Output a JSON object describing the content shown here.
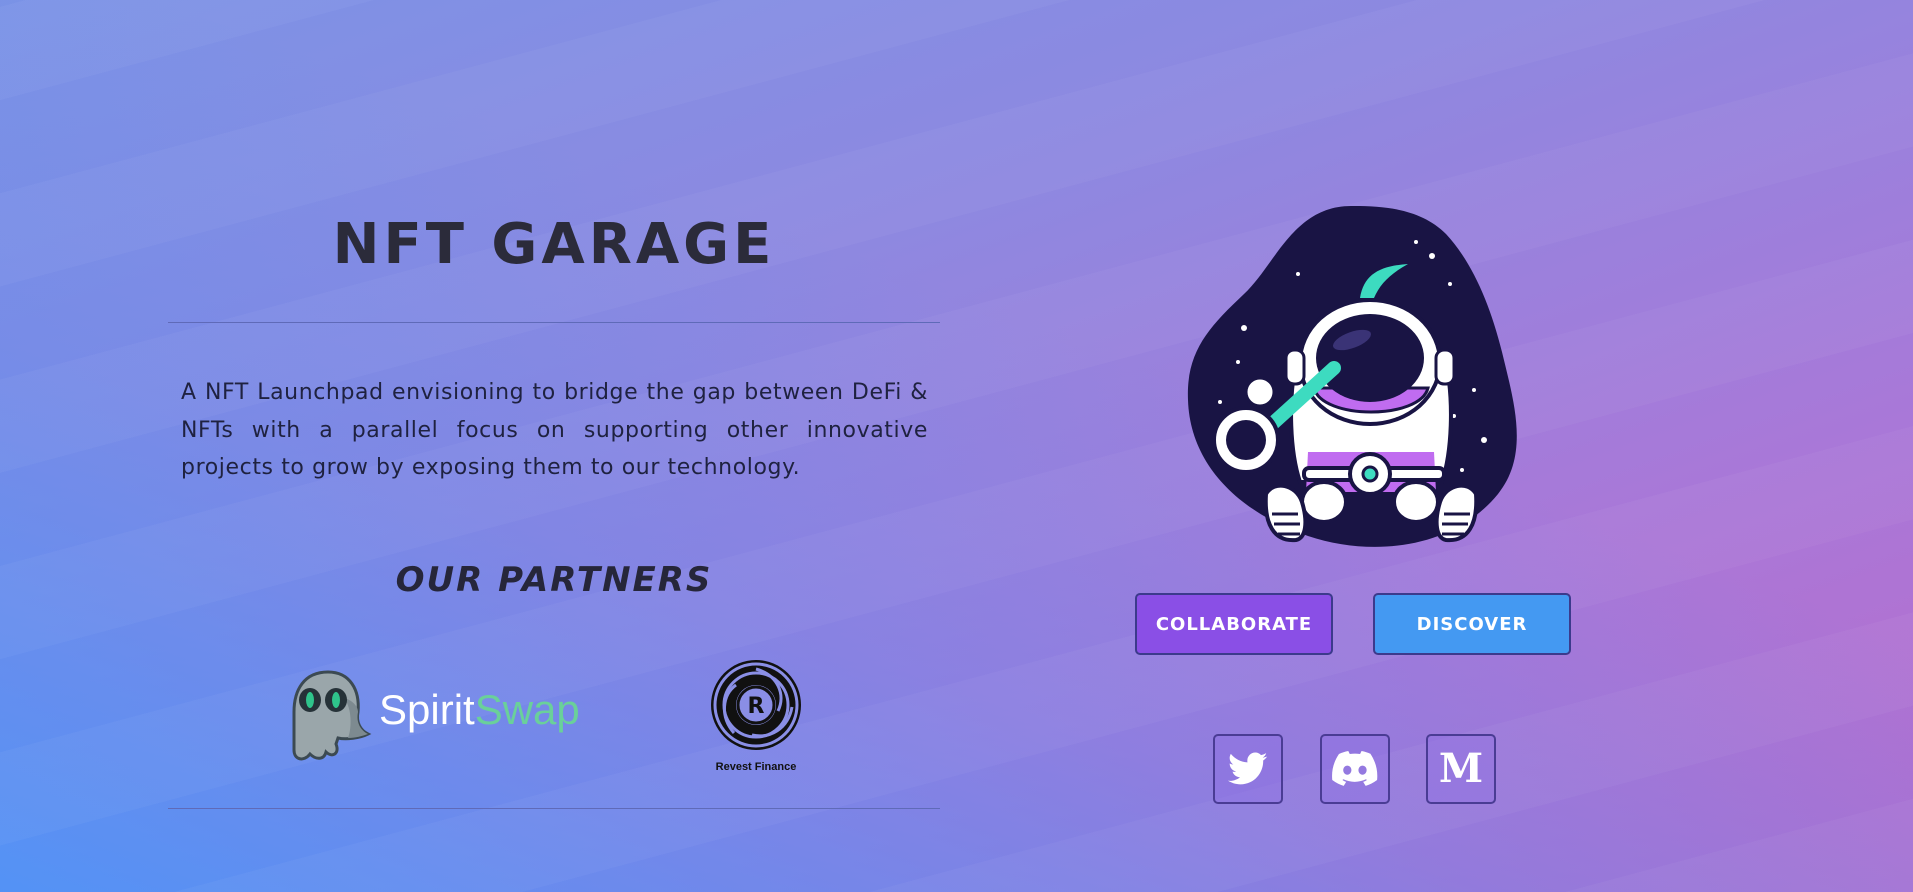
{
  "site": {
    "title": "NFT GARAGE",
    "description": "A NFT Launchpad envisioning to bridge the gap between DeFi & NFTs with a parallel focus on supporting other innovative projects to grow by exposing them to our technology.",
    "partners_heading": "OUR PARTNERS"
  },
  "partners": [
    {
      "name_part1": "Spirit",
      "name_part2": "Swap",
      "icon": "ghost-logo"
    },
    {
      "name": "Revest Finance",
      "icon": "revest-logo"
    }
  ],
  "actions": {
    "collaborate": "COLLABORATE",
    "discover": "DISCOVER"
  },
  "social": [
    {
      "icon": "twitter-icon"
    },
    {
      "icon": "discord-icon"
    },
    {
      "icon": "medium-icon",
      "glyph": "M"
    }
  ],
  "colors": {
    "collaborate_bg": "#8a4fe6",
    "discover_bg": "#4499f2",
    "spirit_accent": "#6ad09a",
    "title_text": "#2b2b3a"
  }
}
